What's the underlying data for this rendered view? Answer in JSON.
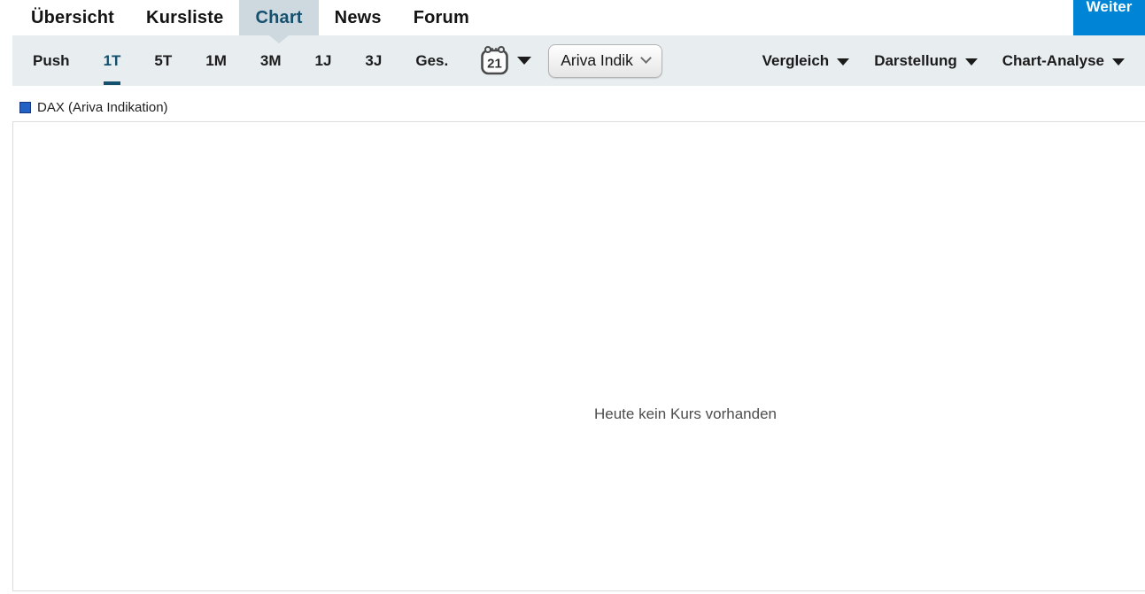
{
  "nav": {
    "items": [
      {
        "label": "Übersicht",
        "active": false
      },
      {
        "label": "Kursliste",
        "active": false
      },
      {
        "label": "Chart",
        "active": true
      },
      {
        "label": "News",
        "active": false
      },
      {
        "label": "Forum",
        "active": false
      }
    ],
    "weiter_button": "Weiter"
  },
  "toolbar": {
    "push": {
      "label": "Push",
      "active": false
    },
    "periods": [
      {
        "label": "1T",
        "active": true
      },
      {
        "label": "5T",
        "active": false
      },
      {
        "label": "1M",
        "active": false
      },
      {
        "label": "3M",
        "active": false
      },
      {
        "label": "1J",
        "active": false
      },
      {
        "label": "3J",
        "active": false
      },
      {
        "label": "Ges.",
        "active": false
      }
    ],
    "calendar": {
      "day": "21"
    },
    "instrument_select": {
      "value": "Ariva Indik"
    },
    "menus": [
      {
        "label": "Vergleich"
      },
      {
        "label": "Darstellung"
      },
      {
        "label": "Chart-Analyse"
      }
    ]
  },
  "legend": {
    "series_name": "DAX (Ariva Indikation)"
  },
  "chart": {
    "empty_message": "Heute kein Kurs vorhanden"
  },
  "colors": {
    "active_tab_bg": "#cdd9df",
    "active_tab_text": "#15506e",
    "toolbar_bg": "#e8edf0",
    "active_period_accent": "#14506e",
    "weiter_button_bg": "#0084d6",
    "series_swatch_fill": "#2262c4",
    "series_swatch_border": "#16377e",
    "empty_message_text": "#4d4d4d"
  }
}
